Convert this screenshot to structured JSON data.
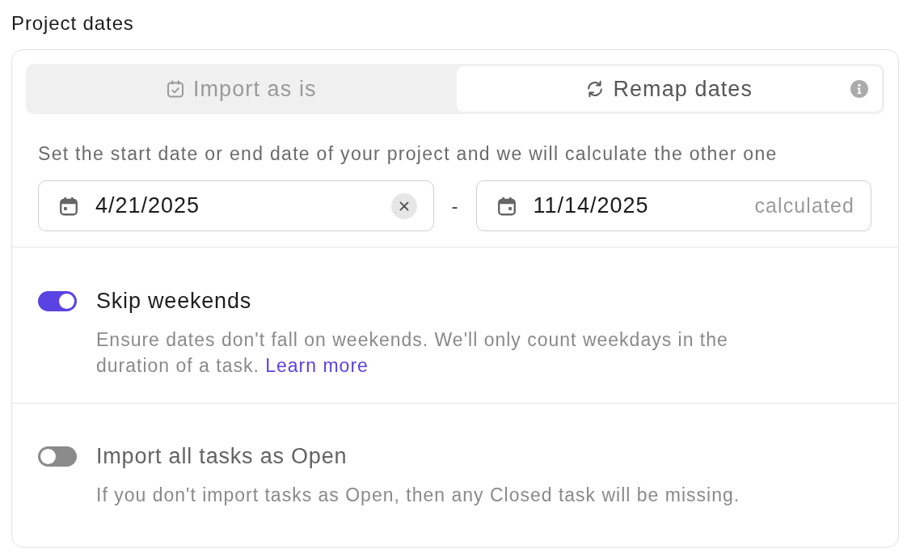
{
  "title": "Project dates",
  "mode_tabs": [
    {
      "label": "Import as is",
      "selected": false,
      "has_info": false
    },
    {
      "label": "Remap dates",
      "selected": true,
      "has_info": true
    }
  ],
  "date_range": {
    "description": "Set the start date or end date of your project and we will calculate the other one",
    "start": {
      "value": "4/21/2025",
      "clearable": true
    },
    "separator": "-",
    "end": {
      "value": "11/14/2025",
      "clearable": false,
      "note": "calculated"
    }
  },
  "options": [
    {
      "label": "Skip weekends",
      "on": true,
      "description": "Ensure dates don't fall on weekends. We'll only count weekdays in the duration of a task.",
      "link": "Learn more"
    },
    {
      "label": "Import all tasks as Open",
      "on": false,
      "description": "If you don't import tasks as Open, then any Closed task will be missing."
    }
  ]
}
